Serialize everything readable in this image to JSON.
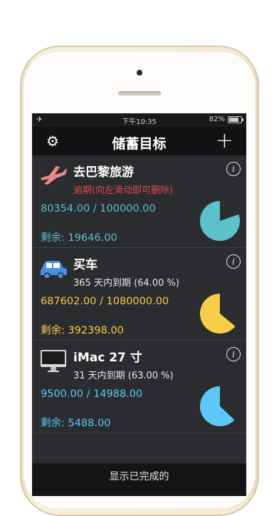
{
  "statusbar": {
    "airplane_icon": "airplane-icon",
    "time": "下午10:35",
    "battery": "82%"
  },
  "navbar": {
    "title": "储蓄目标",
    "settings_icon": "gear-icon",
    "add_icon": "plus-icon"
  },
  "goals": [
    {
      "name": "去巴黎旅游",
      "icon": "airplane-icon",
      "status": "逾期(向左滑动即可删除)",
      "amount": "80354.00 / 100000.00",
      "remaining": "剩余: 19646.00",
      "progress": 0.8035,
      "color": "#5bc2c9"
    },
    {
      "name": "买车",
      "icon": "car-icon",
      "status": "365 天内到期 (64.00 %)",
      "amount": "687602.00 / 1080000.00",
      "remaining": "剩余: 392398.00",
      "progress": 0.64,
      "color": "#f7cd4a"
    },
    {
      "name": "iMac  27 寸",
      "icon": "monitor-icon",
      "status": "31 天内到期 (63.00 %)",
      "amount": "9500.00 / 14988.00",
      "remaining": "剩余: 5488.00",
      "progress": 0.63,
      "color": "#5ec8f7"
    }
  ],
  "footer": {
    "show_completed": "显示已完成的"
  }
}
